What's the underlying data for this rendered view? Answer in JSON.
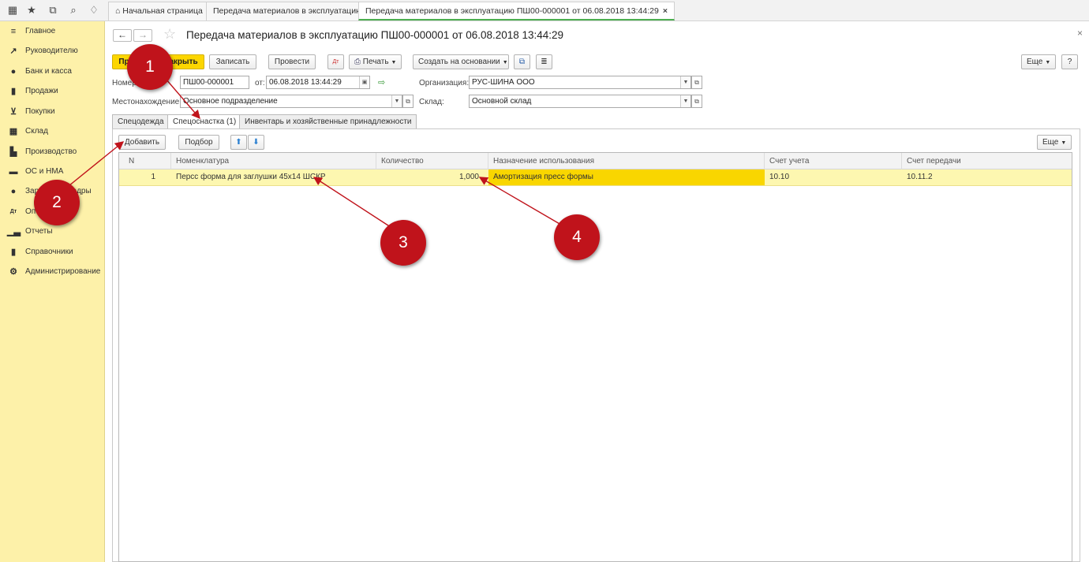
{
  "topbar": {
    "icons": [
      "grid-icon",
      "star-icon",
      "history-icon",
      "search-icon",
      "bell-icon"
    ],
    "tabs": [
      {
        "label": "Начальная страница",
        "icon": "home-icon"
      },
      {
        "label": "Передача материалов в эксплуатацию"
      },
      {
        "label": "Передача материалов в эксплуатацию ПШ00-000001 от 06.08.2018 13:44:29"
      }
    ]
  },
  "sidebar": {
    "items": [
      {
        "label": "Главное",
        "icon": "menu-icon"
      },
      {
        "label": "Руководителю",
        "icon": "chart-trend-icon"
      },
      {
        "label": "Банк и касса",
        "icon": "coin-icon"
      },
      {
        "label": "Продажи",
        "icon": "bag-icon"
      },
      {
        "label": "Покупки",
        "icon": "cart-icon"
      },
      {
        "label": "Склад",
        "icon": "warehouse-icon"
      },
      {
        "label": "Производство",
        "icon": "factory-icon"
      },
      {
        "label": "ОС и НМА",
        "icon": "truck-icon"
      },
      {
        "label": "Зарплата и кадры",
        "icon": "person-icon"
      },
      {
        "label": "Операции",
        "icon": "dt-kt-icon"
      },
      {
        "label": "Отчеты",
        "icon": "bar-chart-icon"
      },
      {
        "label": "Справочники",
        "icon": "book-icon"
      },
      {
        "label": "Администрирование",
        "icon": "gear-icon"
      }
    ]
  },
  "doc": {
    "title": "Передача материалов в эксплуатацию ПШ00-000001 от 06.08.2018 13:44:29"
  },
  "toolbar": {
    "post_close": "Провести и закрыть",
    "save": "Записать",
    "post": "Провести",
    "print": "Печать",
    "create_based": "Создать на основании",
    "more": "Еще",
    "help": "?"
  },
  "form": {
    "number_label": "Номер:",
    "number_value": "ПШ00-000001",
    "from_label": "от:",
    "date_value": "06.08.2018 13:44:29",
    "org_label": "Организация:",
    "org_value": "РУС-ШИНА ООО",
    "location_label": "Местонахождение:",
    "location_value": "Основное подразделение",
    "warehouse_label": "Склад:",
    "warehouse_value": "Основной склад"
  },
  "form_tabs": [
    {
      "label": "Спецодежда"
    },
    {
      "label": "Спецоснастка (1)"
    },
    {
      "label": "Инвентарь и хозяйственные принадлежности"
    }
  ],
  "table_toolbar": {
    "add": "Добавить",
    "pick": "Подбор",
    "more": "Еще"
  },
  "table": {
    "columns": [
      "N",
      "Номенклатура",
      "Количество",
      "Назначение использования",
      "Счет учета",
      "Счет передачи"
    ],
    "rows": [
      {
        "n": "1",
        "item": "Перcс форма для заглушки 45х14 ШСКР",
        "qty": "1,000",
        "purpose": "Амортизация пресс формы",
        "account": "10.10",
        "transfer_account": "10.11.2"
      }
    ]
  },
  "annotations": [
    "1",
    "2",
    "3",
    "4"
  ],
  "colors": {
    "sidebar_bg": "#fdf1a9",
    "accent_yellow": "#fcd600",
    "row_highlight": "#fdf7b0",
    "annotation_red": "#c0131b"
  }
}
